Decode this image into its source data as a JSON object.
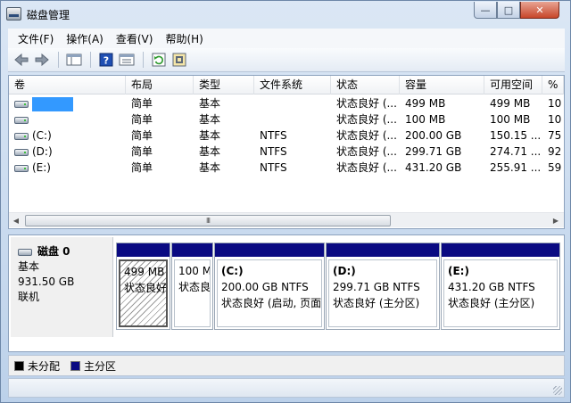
{
  "window": {
    "title": "磁盘管理"
  },
  "caption": {
    "minimize": "—",
    "maximize": "□",
    "close": "✕"
  },
  "menu": [
    "文件(F)",
    "操作(A)",
    "查看(V)",
    "帮助(H)"
  ],
  "toolbar_icons": [
    "back-arrow-icon",
    "forward-arrow-icon",
    "console-tree-icon",
    "help-icon",
    "properties-icon",
    "refresh-icon",
    "settings-icon"
  ],
  "columns": [
    "卷",
    "布局",
    "类型",
    "文件系统",
    "状态",
    "容量",
    "可用空间",
    "%"
  ],
  "volumes": [
    {
      "name": "",
      "layout": "简单",
      "type": "基本",
      "fs": "",
      "status": "状态良好 (...",
      "capacity": "499 MB",
      "free": "499 MB",
      "pct": "10"
    },
    {
      "name": "",
      "layout": "简单",
      "type": "基本",
      "fs": "",
      "status": "状态良好 (...",
      "capacity": "100 MB",
      "free": "100 MB",
      "pct": "10"
    },
    {
      "name": "(C:)",
      "layout": "简单",
      "type": "基本",
      "fs": "NTFS",
      "status": "状态良好 (...",
      "capacity": "200.00 GB",
      "free": "150.15 ...",
      "pct": "75"
    },
    {
      "name": "(D:)",
      "layout": "简单",
      "type": "基本",
      "fs": "NTFS",
      "status": "状态良好 (...",
      "capacity": "299.71 GB",
      "free": "274.71 ...",
      "pct": "92"
    },
    {
      "name": "(E:)",
      "layout": "简单",
      "type": "基本",
      "fs": "NTFS",
      "status": "状态良好 (...",
      "capacity": "431.20 GB",
      "free": "255.91 ...",
      "pct": "59"
    }
  ],
  "disk": {
    "name": "磁盘 0",
    "type": "基本",
    "size": "931.50 GB",
    "state": "联机"
  },
  "partitions": [
    {
      "title": "",
      "line1": "499 MB",
      "line2": "状态良好"
    },
    {
      "title": "",
      "line1": "100 M",
      "line2": "状态良"
    },
    {
      "title": "(C:)",
      "line1": "200.00 GB NTFS",
      "line2": "状态良好 (启动, 页面"
    },
    {
      "title": "(D:)",
      "line1": "299.71 GB NTFS",
      "line2": "状态良好 (主分区)"
    },
    {
      "title": "(E:)",
      "line1": "431.20 GB NTFS",
      "line2": "状态良好 (主分区)"
    }
  ],
  "legend": [
    {
      "label": "未分配",
      "color": "#000000"
    },
    {
      "label": "主分区",
      "color": "#0a0a82"
    }
  ],
  "scroll": {
    "thumb": "III",
    "left": "◀",
    "right": "▶"
  }
}
